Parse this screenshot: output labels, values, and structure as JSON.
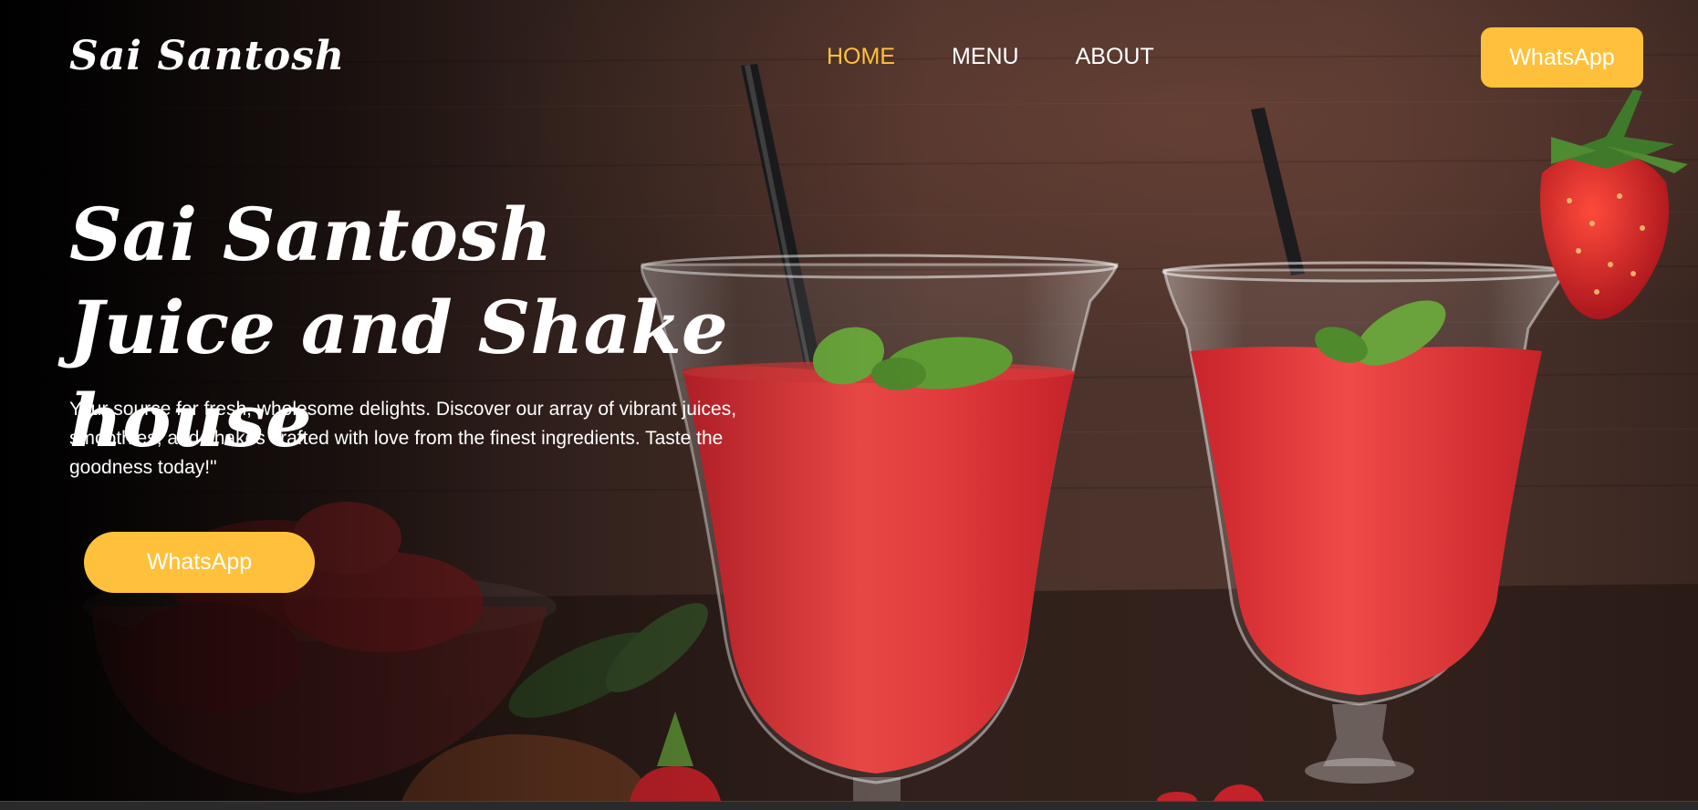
{
  "nav": {
    "brand": "Sai Santosh",
    "links": [
      "HOME",
      "MENU",
      "ABOUT"
    ],
    "active_index": 0,
    "cta_label": "WhatsApp"
  },
  "hero": {
    "title": "Sai Santosh Juice and Shake house",
    "description": "Your source for fresh, wholesome delights. Discover our array of vibrant juices, smoothies, and shakes crafted with love from the finest ingredients. Taste the goodness today!\"",
    "cta_label": "WhatsApp"
  },
  "colors": {
    "accent": "#ffc13b",
    "text": "#ffffff",
    "juice": "#e8363a"
  }
}
